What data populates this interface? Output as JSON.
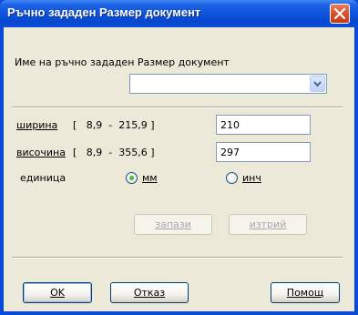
{
  "window": {
    "title": "Ръчно зададен Размер документ"
  },
  "form": {
    "name_label": "Име на ръчно зададен Размер документ",
    "name_value": "",
    "width_label": "ширина",
    "width_range": "[   8,9  -  215,9 ]",
    "width_value": "210",
    "height_label": "височина",
    "height_range": "[   8,9  -  355,6 ]",
    "height_value": "297",
    "unit_label": "единица",
    "unit_mm": "мм",
    "unit_inch": "инч",
    "unit_selected": "мм"
  },
  "buttons": {
    "save": "запази",
    "delete": "изтрий",
    "ok": "OK",
    "cancel": "Отказ",
    "help": "Помощ"
  },
  "colors": {
    "titlebar": "#0a52dc",
    "client_bg": "#ece9d8",
    "close": "#d8502a"
  }
}
